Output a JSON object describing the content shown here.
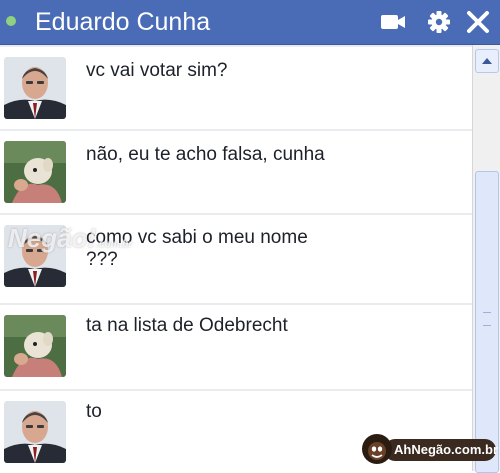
{
  "window": {
    "contact_name": "Eduardo Cunha",
    "status": "online",
    "status_color": "#8fd17e",
    "header_color": "#4a6cb6",
    "icons": [
      "video-camera-icon",
      "gear-icon",
      "close-icon"
    ]
  },
  "messages": [
    {
      "sender": "Eduardo Cunha",
      "avatar": "man-in-suit",
      "text": "vc vai votar sim?"
    },
    {
      "sender": "other",
      "avatar": "person-with-animal",
      "text": "não, eu te acho falsa, cunha"
    },
    {
      "sender": "Eduardo Cunha",
      "avatar": "man-in-suit",
      "text": "como vc sabi o meu nome\n???"
    },
    {
      "sender": "other",
      "avatar": "person-with-animal",
      "text": "ta na lista de Odebrecht"
    },
    {
      "sender": "Eduardo Cunha",
      "avatar": "man-in-suit",
      "text": "to"
    }
  ],
  "watermark": {
    "main": "Negão!",
    "sub": ".com.br"
  },
  "badge": {
    "text": "AhNegão.com.br"
  }
}
